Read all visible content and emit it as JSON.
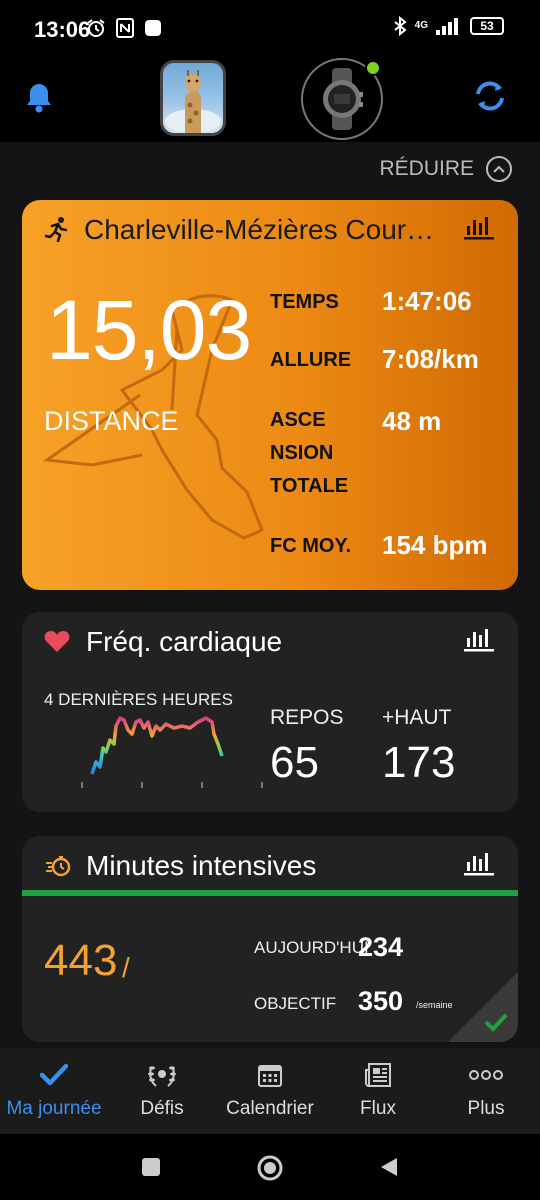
{
  "status": {
    "time": "13:06",
    "network": "4G",
    "battery": "53"
  },
  "header": {},
  "reduce": {
    "label": "RÉDUIRE"
  },
  "activity": {
    "title": "Charleville-Mézières Cour…",
    "distance": "15,03",
    "distance_label": "DISTANCE",
    "stats": [
      {
        "label_lines": [
          "TEMPS"
        ],
        "value": "1:47:06"
      },
      {
        "label_lines": [
          "ALLURE"
        ],
        "value": "7:08/km"
      },
      {
        "label_lines": [
          "ASCE",
          "NSION",
          "TOTALE"
        ],
        "value": "48 m"
      },
      {
        "label_lines": [
          "FC MOY."
        ],
        "value": "154 bpm"
      }
    ],
    "color": "#f39a1f"
  },
  "heart_rate": {
    "title": "Fréq. cardiaque",
    "period": "4 DERNIÈRES HEURES",
    "rest_label": "REPOS",
    "rest_value": "65",
    "high_label": "+HAUT",
    "high_value": "173"
  },
  "intensity": {
    "title": "Minutes intensives",
    "total": "443",
    "slash": "/",
    "today_label": "AUJOURD'HUI",
    "today_value": "234",
    "goal_label": "OBJECTIF",
    "goal_value": "350",
    "goal_unit": "/semaine",
    "bar_color": "#1fa141"
  },
  "nav": {
    "items": [
      {
        "label": "Ma journée",
        "icon": "check-icon",
        "active": true
      },
      {
        "label": "Défis",
        "icon": "laurel-icon"
      },
      {
        "label": "Calendrier",
        "icon": "calendar-icon"
      },
      {
        "label": "Flux",
        "icon": "news-icon"
      },
      {
        "label": "Plus",
        "icon": "more-icon"
      }
    ]
  },
  "accent_color": "#3b8ff0"
}
